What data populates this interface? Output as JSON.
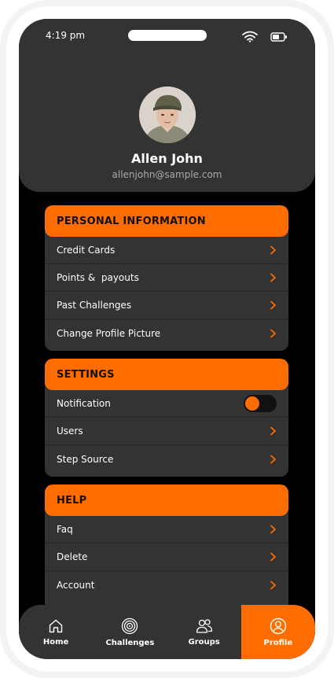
{
  "status_bar": {
    "time": "4:19 pm"
  },
  "profile": {
    "name": "Allen John",
    "email": "allenjohn@sample.com"
  },
  "sections": {
    "personal": {
      "title": "PERSONAL INFORMATION",
      "items": [
        "Credit Cards",
        "Points &  payouts",
        "Past Challenges",
        "Change Profile Picture"
      ]
    },
    "settings": {
      "title": "SETTINGS",
      "items": [
        "Notification",
        "Users",
        "Step Source"
      ],
      "notification_enabled": true
    },
    "help": {
      "title": "HELP",
      "items": [
        "Faq",
        "Delete",
        "Account"
      ]
    }
  },
  "tabbar": {
    "tabs": [
      "Home",
      "Challenges",
      "Groups",
      "Profile"
    ],
    "active": "Profile"
  },
  "colors": {
    "accent": "#ff6d00",
    "card": "#333333",
    "background": "#000000"
  }
}
